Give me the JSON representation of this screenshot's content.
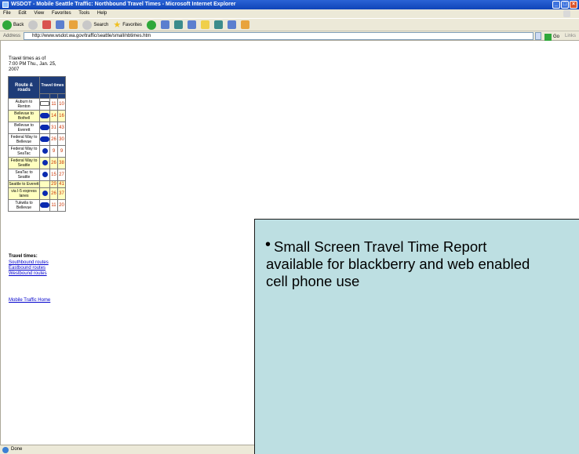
{
  "window": {
    "title": "WSDOT - Mobile Seattle Traffic: Northbound Travel Times - Microsoft Internet Explorer"
  },
  "menu": {
    "items": [
      "File",
      "Edit",
      "View",
      "Favorites",
      "Tools",
      "Help"
    ]
  },
  "toolbar": {
    "back_label": "Back",
    "search_label": "Search",
    "favorites_label": "Favorites"
  },
  "address": {
    "label": "Address",
    "url": "http://www.wsdot.wa.gov/traffic/seattle/small/nbtimes.htm",
    "go_label": "Go",
    "links_label": "Links"
  },
  "page": {
    "timestamp_line1": "Travel times as of",
    "timestamp_line2": "7:00 PM Thu., Jan. 25,",
    "timestamp_line3": "2007",
    "table_headers": {
      "route": "Route & roads",
      "times": "Travel times",
      "sub_hov": "",
      "sub_gp": ""
    },
    "rows": [
      {
        "route": "Auburn to Renton",
        "marker": "box",
        "gp": "11",
        "hov": "10",
        "yellow": false
      },
      {
        "route": "Bellevue to Bothell",
        "marker": "pill",
        "gp": "14",
        "hov": "16",
        "yellow": true
      },
      {
        "route": "Bellevue to Everett",
        "marker": "pill",
        "gp": "31",
        "hov": "43",
        "yellow": false
      },
      {
        "route": "Federal Way to Bellevue",
        "marker": "pill",
        "gp": "26",
        "hov": "30",
        "yellow": false
      },
      {
        "route": "Federal Way to SeaTac",
        "marker": "dot",
        "gp": "9",
        "hov": "9",
        "yellow": false
      },
      {
        "route": "Federal Way to Seattle",
        "marker": "dot",
        "gp": "26",
        "hov": "38",
        "yellow": true
      },
      {
        "route": "SeaTac to Seattle",
        "marker": "dot",
        "gp": "15",
        "hov": "27",
        "yellow": false
      },
      {
        "route": "Seattle to Everett",
        "marker": "",
        "gp": "29",
        "hov": "41",
        "yellow": true
      },
      {
        "route": "via I-5 express lanes",
        "marker": "dot",
        "gp": "26",
        "hov": "37",
        "yellow": true
      },
      {
        "route": "Tukwila to Bellevue",
        "marker": "pill",
        "gp": "11",
        "hov": "20",
        "yellow": false
      }
    ],
    "section_title": "Travel times:",
    "links": [
      "Southbound routes",
      "Eastbound routes",
      "Westbound routes"
    ],
    "home_link": "Mobile Traffic Home"
  },
  "status": {
    "text": "Done"
  },
  "overlay": {
    "bullet": "•",
    "line1": "Small Screen Travel Time Report",
    "line2": "available for blackberry and web enabled",
    "line3": "cell phone use"
  }
}
